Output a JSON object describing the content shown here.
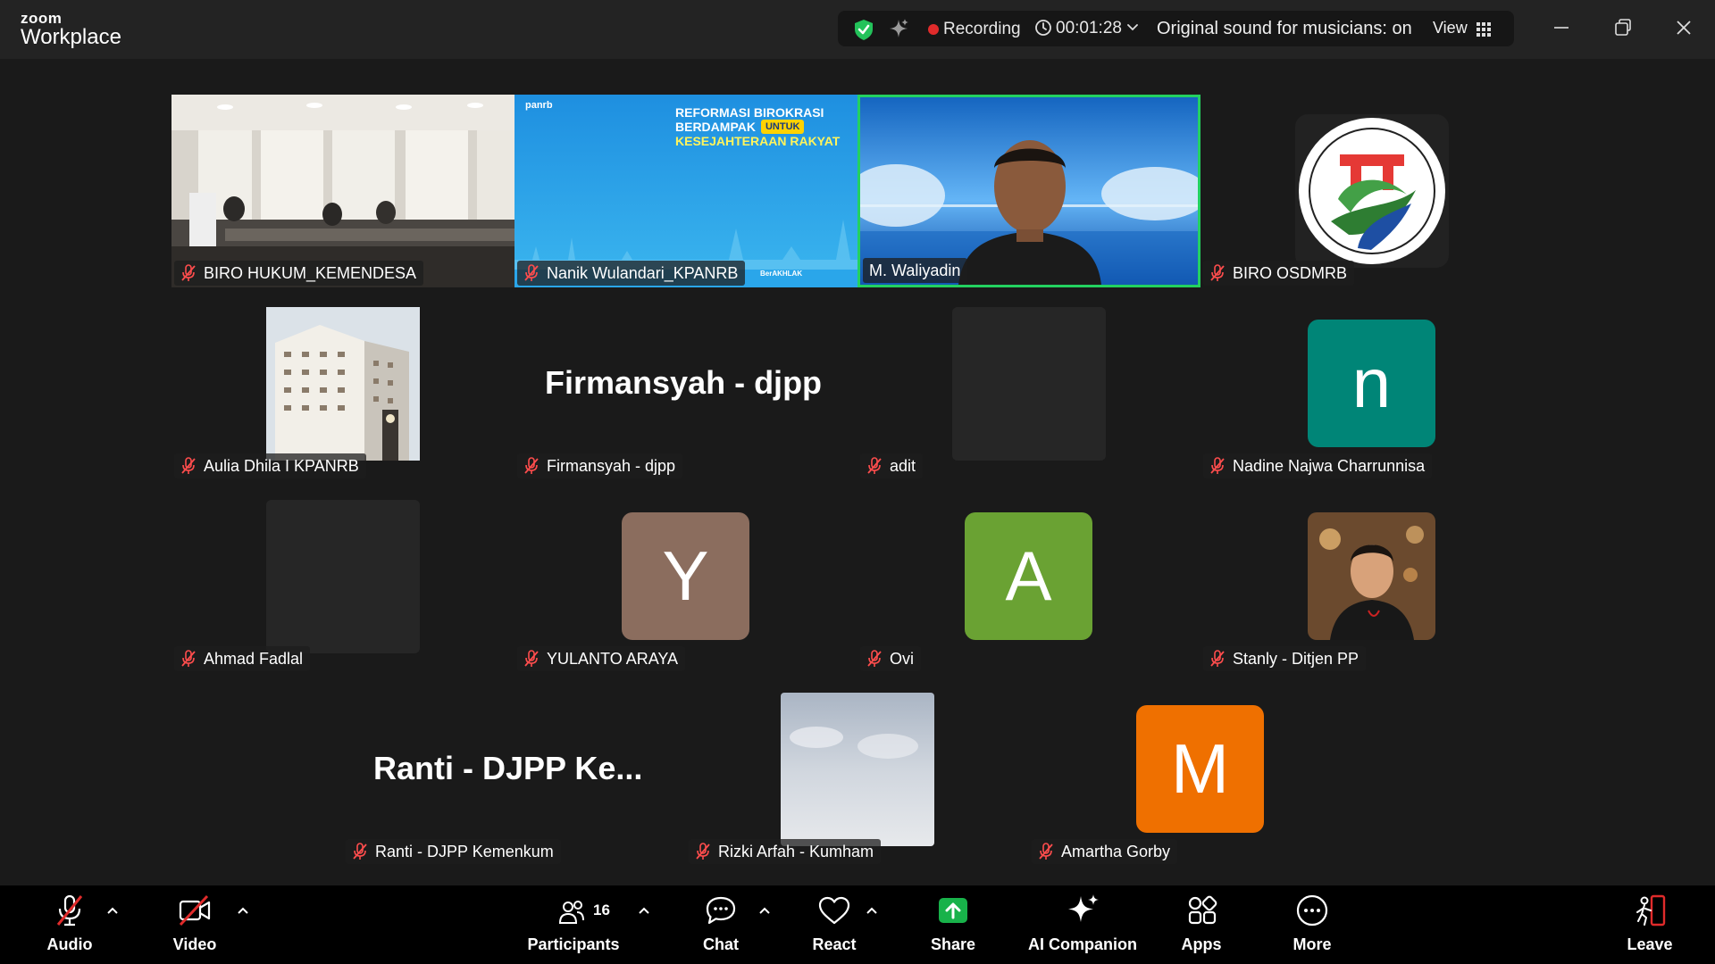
{
  "app": {
    "brand_top": "zoom",
    "brand_bottom": "Workplace"
  },
  "status": {
    "recording_label": "Recording",
    "timer": "00:01:28",
    "original_sound": "Original sound for musicians: on",
    "view_label": "View"
  },
  "participants": {
    "p1": "BIRO HUKUM_KEMENDESA",
    "p2": "Nanik Wulandari_KPANRB",
    "p3": "M. Waliyadin",
    "p4": "BIRO OSDMRB",
    "p5": "Aulia Dhila I KPANRB",
    "p6": "Firmansyah - djpp",
    "p6_big": "Firmansyah - djpp",
    "p7": "adit",
    "p8": "Nadine Najwa Charrunnisa",
    "p8_initial": "n",
    "p9": "Ahmad Fadlal",
    "p10": "YULANTO ARAYA",
    "p10_initial": "Y",
    "p11": "Ovi",
    "p11_initial": "A",
    "p12": "Stanly - Ditjen PP",
    "p13": "Ranti - DJPP Kemenkum",
    "p13_big": "Ranti - DJPP Ke...",
    "p14": "Rizki Arfah - Kumham",
    "p15": "Amartha Gorby",
    "p15_initial": "M"
  },
  "slide": {
    "logo_text": "panrb",
    "line1": "REFORMASI BIROKRASI",
    "line2": "BERDAMPAK",
    "badge": "UNTUK",
    "line3": "KESEJAHTERAAN RAKYAT",
    "footer1": "BerAKHLAK"
  },
  "toolbar": {
    "audio": "Audio",
    "video": "Video",
    "participants": "Participants",
    "participants_count": "16",
    "chat": "Chat",
    "react": "React",
    "share": "Share",
    "ai_companion": "AI Companion",
    "apps": "Apps",
    "more": "More",
    "leave": "Leave"
  },
  "colors": {
    "avatar_n": "#008577",
    "avatar_y": "#8b6d5e",
    "avatar_a": "#6aa233",
    "avatar_m": "#ef7000",
    "active_speaker": "#23d160",
    "share_green": "#18b24a",
    "recording_red": "#e02b2b"
  }
}
